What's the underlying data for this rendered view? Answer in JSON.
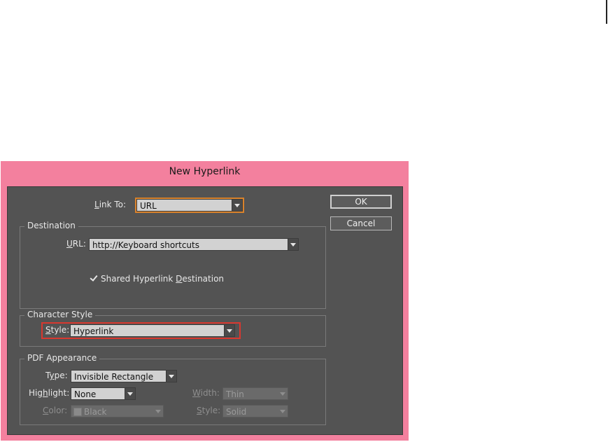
{
  "dialog": {
    "title": "New Hyperlink",
    "link_to": {
      "label_underline": "L",
      "label_rest": "ink To:",
      "value": "URL"
    },
    "buttons": {
      "ok": "OK",
      "cancel": "Cancel"
    },
    "destination": {
      "title": "Destination",
      "url": {
        "label_underline": "U",
        "label_rest": "RL:",
        "value": "http://Keyboard shortcuts"
      },
      "shared": {
        "checked": true,
        "text_before": "Shared Hyperlink ",
        "text_underline": "D",
        "text_after": "estination"
      }
    },
    "character_style": {
      "title": "Character Style",
      "style": {
        "label_underline": "S",
        "label_rest": "tyle:",
        "value": "Hyperlink"
      }
    },
    "pdf_appearance": {
      "title": "PDF Appearance",
      "type": {
        "label_before": "T",
        "label_underline": "y",
        "label_after": "pe:",
        "value": "Invisible Rectangle"
      },
      "highlight": {
        "label_before": "Hig",
        "label_underline": "h",
        "label_after": "light:",
        "value": "None"
      },
      "color": {
        "label_underline": "C",
        "label_rest": "olor:",
        "value": "Black"
      },
      "width": {
        "label_underline": "W",
        "label_rest": "idth:",
        "value": "Thin"
      },
      "style": {
        "label_underline": "S",
        "label_rest": "tyle:",
        "value": "Solid"
      }
    }
  }
}
